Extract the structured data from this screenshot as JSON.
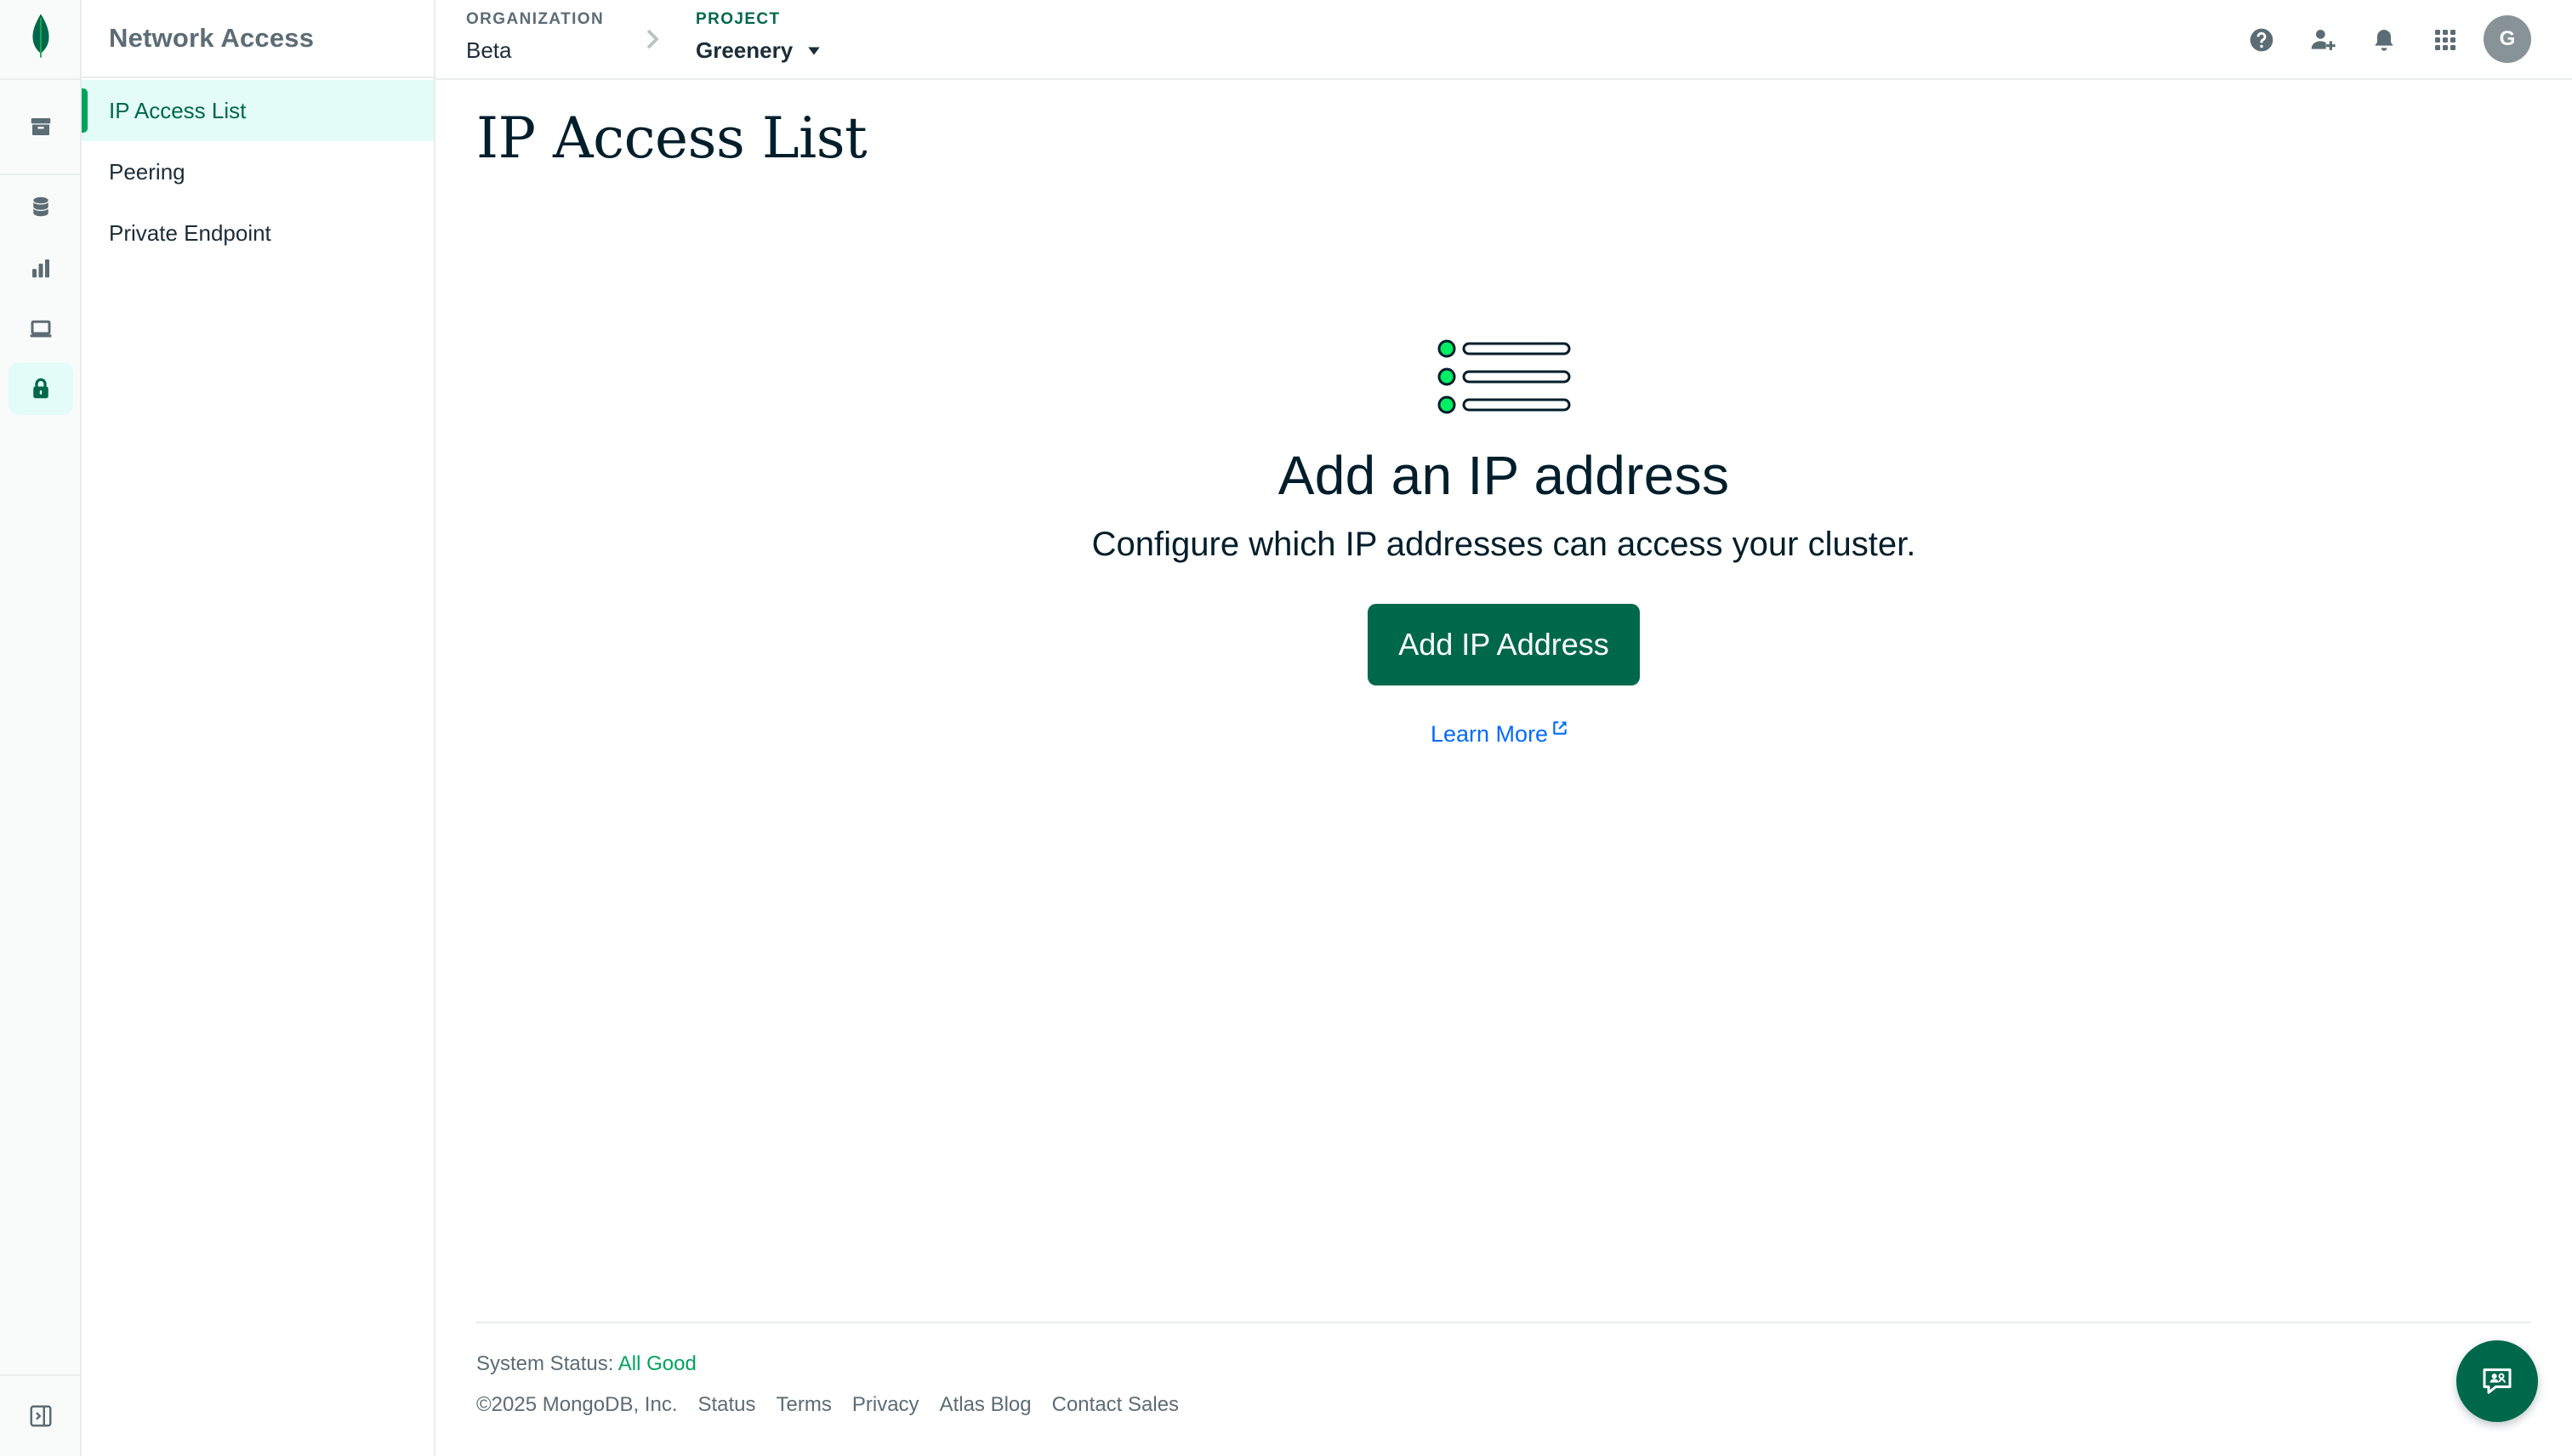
{
  "colors": {
    "brand": "#00684a",
    "accent": "#00a35c",
    "active_bg": "#e3fcf7",
    "link": "#016bf8",
    "text": "#001e2b",
    "muted": "#5c6c75"
  },
  "rail": {
    "logo_icon": "mongodb-leaf-icon",
    "items": [
      {
        "icon": "archive-icon",
        "active": false
      },
      {
        "icon": "database-icon",
        "active": false
      },
      {
        "icon": "chart-icon",
        "active": false
      },
      {
        "icon": "laptop-icon",
        "active": false
      },
      {
        "icon": "lock-icon",
        "active": true
      }
    ],
    "collapse_icon": "collapse-sidebar-icon"
  },
  "sidebar": {
    "title": "Network Access",
    "items": [
      {
        "label": "IP Access List",
        "active": true
      },
      {
        "label": "Peering",
        "active": false
      },
      {
        "label": "Private Endpoint",
        "active": false
      }
    ]
  },
  "breadcrumb": {
    "organization": {
      "label": "ORGANIZATION",
      "value": "Beta"
    },
    "project": {
      "label": "PROJECT",
      "value": "Greenery"
    }
  },
  "topbar": {
    "icons": [
      "help-icon",
      "invite-user-icon",
      "bell-icon",
      "apps-grid-icon"
    ],
    "avatar_initial": "G"
  },
  "main": {
    "title": "IP Access List",
    "empty_state": {
      "icon": "list-illustration-icon",
      "heading": "Add an IP address",
      "description": "Configure which IP addresses can access your cluster.",
      "button_label": "Add IP Address",
      "link_label": "Learn More"
    }
  },
  "footer": {
    "status_label": "System Status:",
    "status_value": "All Good",
    "copyright": "©2025 MongoDB, Inc.",
    "links": [
      "Status",
      "Terms",
      "Privacy",
      "Atlas Blog",
      "Contact Sales"
    ]
  },
  "chat": {
    "icon": "chat-support-icon"
  }
}
